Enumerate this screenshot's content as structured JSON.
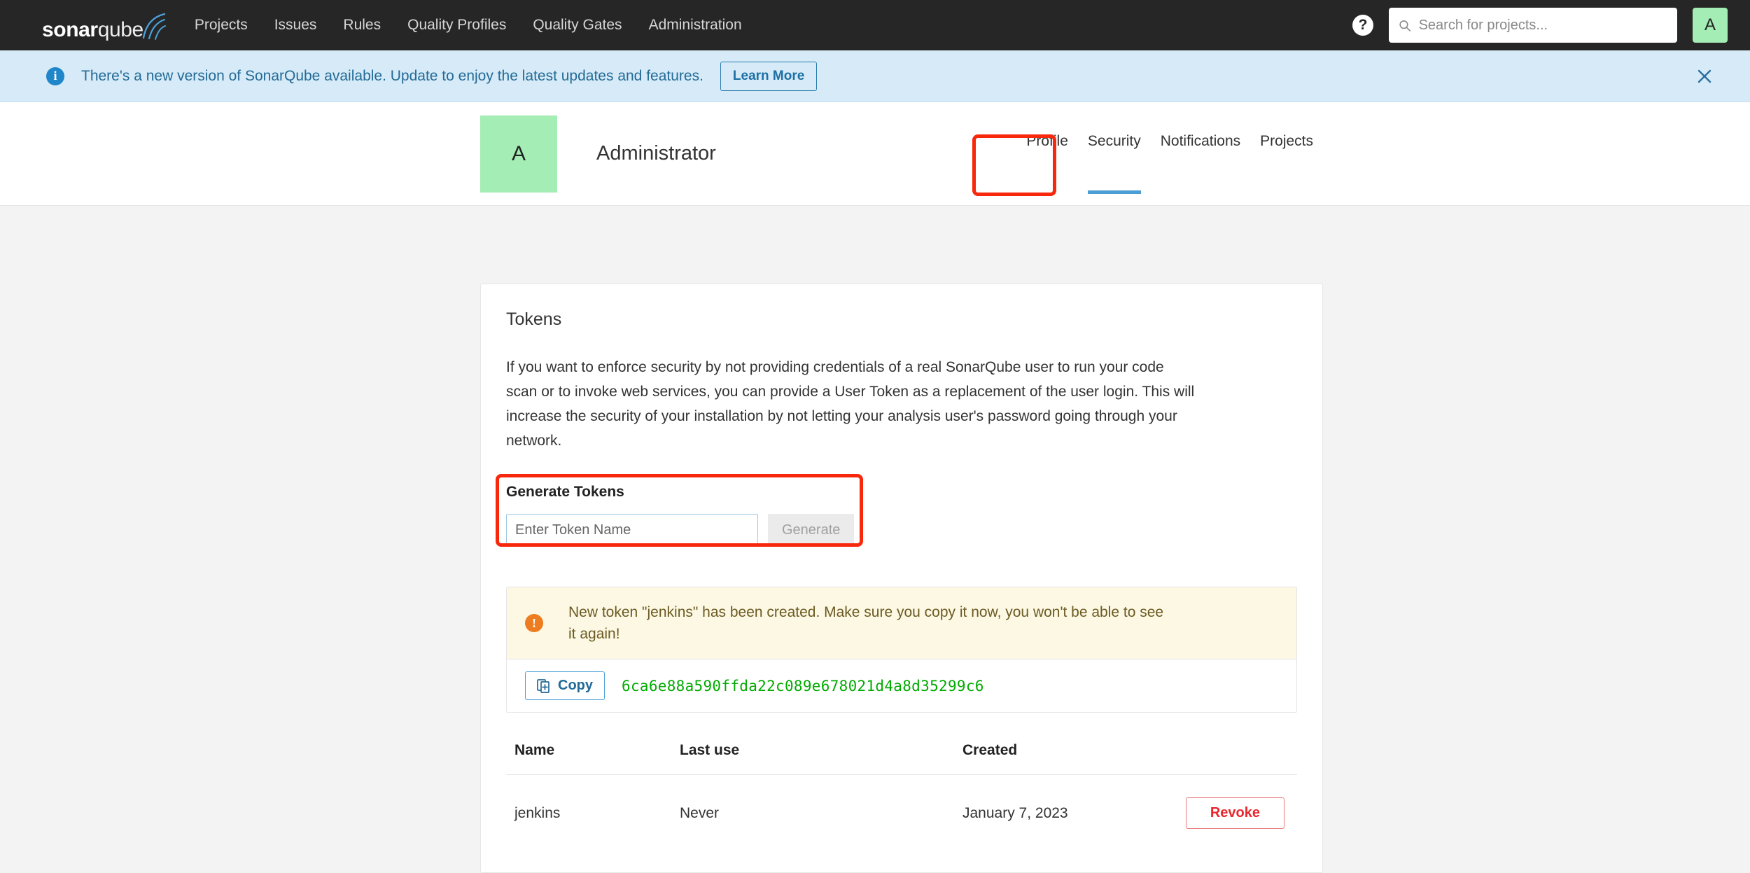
{
  "navbar": {
    "logo": {
      "bold": "sonar",
      "light": "qube",
      "icon": "sonarqube-logo"
    },
    "links": [
      {
        "label": "Projects"
      },
      {
        "label": "Issues"
      },
      {
        "label": "Rules"
      },
      {
        "label": "Quality Profiles"
      },
      {
        "label": "Quality Gates"
      },
      {
        "label": "Administration"
      }
    ],
    "help_icon": "help-icon",
    "help_glyph": "?",
    "search": {
      "placeholder": "Search for projects...",
      "value": "",
      "icon": "search-icon"
    },
    "avatar": {
      "initial": "A",
      "color": "#a4edb5"
    }
  },
  "banner": {
    "icon": "info-icon",
    "icon_glyph": "i",
    "message": "There's a new version of SonarQube available. Update to enjoy the latest updates and features.",
    "button_label": "Learn More",
    "close_icon": "close-icon",
    "background": "#d6ebf7",
    "text_color": "#236a97"
  },
  "profile": {
    "avatar_initial": "A",
    "name": "Administrator",
    "tabs": [
      {
        "label": "Profile",
        "active": false
      },
      {
        "label": "Security",
        "active": true
      },
      {
        "label": "Notifications",
        "active": false
      },
      {
        "label": "Projects",
        "active": false
      }
    ],
    "active_tab_underline_color": "#4b9fd5"
  },
  "annotations": {
    "color": "#f8280c",
    "boxes": [
      {
        "name": "security-tab-highlight"
      },
      {
        "name": "generate-tokens-highlight"
      }
    ]
  },
  "tokens_card": {
    "title": "Tokens",
    "description": "If you want to enforce security by not providing credentials of a real SonarQube user to run your code scan or to invoke web services, you can provide a User Token as a replacement of the user login. This will increase the security of your installation by not letting your analysis user's password going through your network.",
    "generate": {
      "title": "Generate Tokens",
      "input_placeholder": "Enter Token Name",
      "input_value": "",
      "button_label": "Generate",
      "button_disabled": true
    },
    "alert": {
      "icon": "warning-icon",
      "icon_glyph": "!",
      "message": "New token \"jenkins\" has been created. Make sure you copy it now, you won't be able to see it again!",
      "background": "#fcf8e3"
    },
    "token_display": {
      "copy_label": "Copy",
      "copy_icon": "clipboard-icon",
      "token": "6ca6e88a590ffda22c089e678021d4a8d35299c6",
      "token_color": "#00aa00"
    },
    "table": {
      "headers": {
        "name": "Name",
        "last_use": "Last use",
        "created": "Created",
        "action": ""
      },
      "rows": [
        {
          "name": "jenkins",
          "last_use": "Never",
          "created": "January 7, 2023",
          "action_label": "Revoke"
        }
      ]
    }
  }
}
